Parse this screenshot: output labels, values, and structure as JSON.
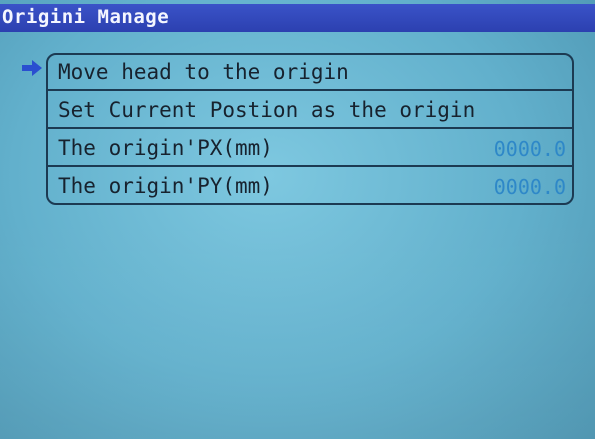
{
  "screen": {
    "title": "Origini Manage"
  },
  "menu": {
    "selected_index": 0,
    "items": [
      {
        "label": "Move head to the origin",
        "value": ""
      },
      {
        "label": "Set Current Postion as the origin",
        "value": ""
      },
      {
        "label": "The origin'PX(mm)",
        "value": "0000.0"
      },
      {
        "label": "The origin'PY(mm)",
        "value": "0000.0"
      }
    ]
  },
  "icons": {
    "cursor": "right-arrow-icon"
  },
  "colors": {
    "title_bar": "#2c40b0",
    "screen_bg": "#62b0cc",
    "value_text": "#2e88c8",
    "cursor": "#2a4fd0"
  }
}
